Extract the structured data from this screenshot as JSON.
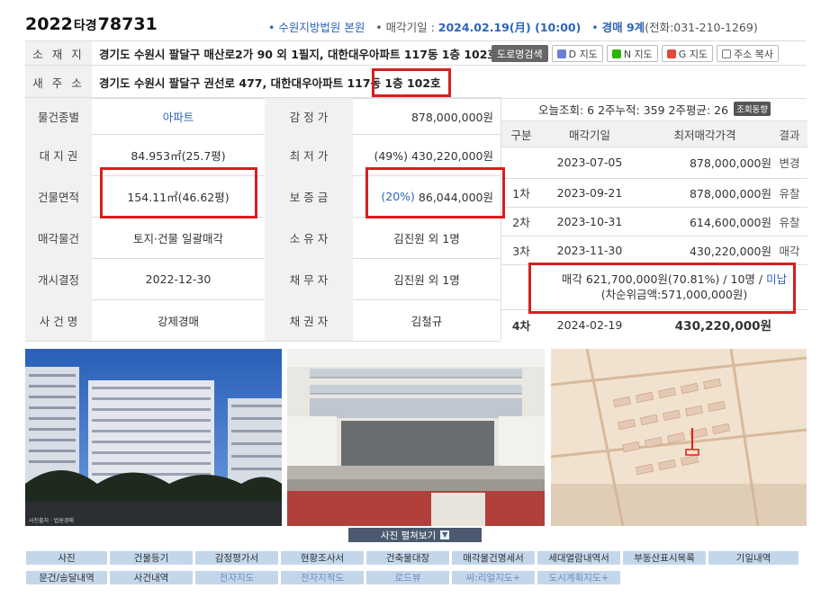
{
  "header": {
    "case_year": "2022",
    "case_type": "타경",
    "case_number": "78731",
    "court": "• 수원지방법원 본원",
    "sale_date_label": "• 매각기일 : ",
    "sale_date": "2024.02.19(月) (10:00)",
    "dept_prefix": "• ",
    "dept": "경매 9계",
    "phone": "(전화:031-210-1269)"
  },
  "address": {
    "location_label": "소 재 지",
    "location_value": "경기도 수원시 팔달구 매산로2가 90 외 1필지, 대한대우아파트 117동 1층 102호",
    "road_label": "새 주 소",
    "road_value": "경기도 수원시 팔달구 권선로 477, 대한대우아파트 117동 1층 102호",
    "buttons": [
      "도로명검색",
      "D 지도",
      "N 지도",
      "G 지도",
      "주소 복사"
    ]
  },
  "info": {
    "rows": [
      {
        "l1": "물건종별",
        "v1": "아파트",
        "l2": "감 정 가",
        "v2": "878,000,000원"
      },
      {
        "l1": "대 지 권",
        "v1": "84.953㎡(25.7평)",
        "l2": "최 저 가",
        "v2": "(49%) 430,220,000원"
      },
      {
        "l1": "건물면적",
        "v1": "154.11㎡(46.62평)",
        "l2": "보 증 금",
        "v2_pct": "(20%)",
        "v2": "86,044,000원"
      },
      {
        "l1": "매각물건",
        "v1": "토지·건물 일괄매각",
        "l2": "소 유 자",
        "v2": "김진원 외 1명"
      },
      {
        "l1": "개시결정",
        "v1": "2022-12-30",
        "l2": "채 무 자",
        "v2": "김진원 외 1명"
      },
      {
        "l1": "사 건 명",
        "v1": "강제경매",
        "l2": "채 권 자",
        "v2": "김철규"
      }
    ]
  },
  "history": {
    "views": "오늘조회: 6  2주누적: 359  2주평균: 26",
    "views_badge": "조회동향",
    "headers": [
      "구분",
      "매각기일",
      "최저매각가격",
      "결과"
    ],
    "rows": [
      {
        "round": "",
        "date": "2023-07-05",
        "price": "878,000,000원",
        "result": "변경"
      },
      {
        "round": "1차",
        "date": "2023-09-21",
        "price": "878,000,000원",
        "result": "유찰"
      },
      {
        "round": "2차",
        "date": "2023-10-31",
        "price": "614,600,000원",
        "result": "유찰"
      },
      {
        "round": "3차",
        "date": "2023-11-30",
        "price": "430,220,000원",
        "result": "매각"
      }
    ],
    "sale_line1": "매각 621,700,000원(70.81%) / 10명 / ",
    "sale_unpaid": "미납",
    "sale_line2": "(차순위금액:571,000,000원)",
    "next": {
      "round": "4차",
      "date": "2024-02-19",
      "price": "430,220,000원"
    }
  },
  "photos": {
    "view_all": "사진 펼쳐보기",
    "photo1_caption": "사진출처 · 법원경매"
  },
  "bottom_buttons": {
    "row1": [
      "사진",
      "건물등기",
      "감정평가서",
      "현황조사서",
      "건축물대장",
      "매각물건명세서",
      "세대열람내역서",
      "부동산표시목록",
      "기일내역"
    ],
    "row2": [
      "문건/송달내역",
      "사건내역",
      "전자지도",
      "전자지적도",
      "로드뷰",
      "씨:리얼지도+",
      "도시계획지도+"
    ]
  },
  "colors": {
    "accent": "#2d64bb",
    "highlight": "#d61f1f",
    "button_bg": "#c4d6ea"
  }
}
